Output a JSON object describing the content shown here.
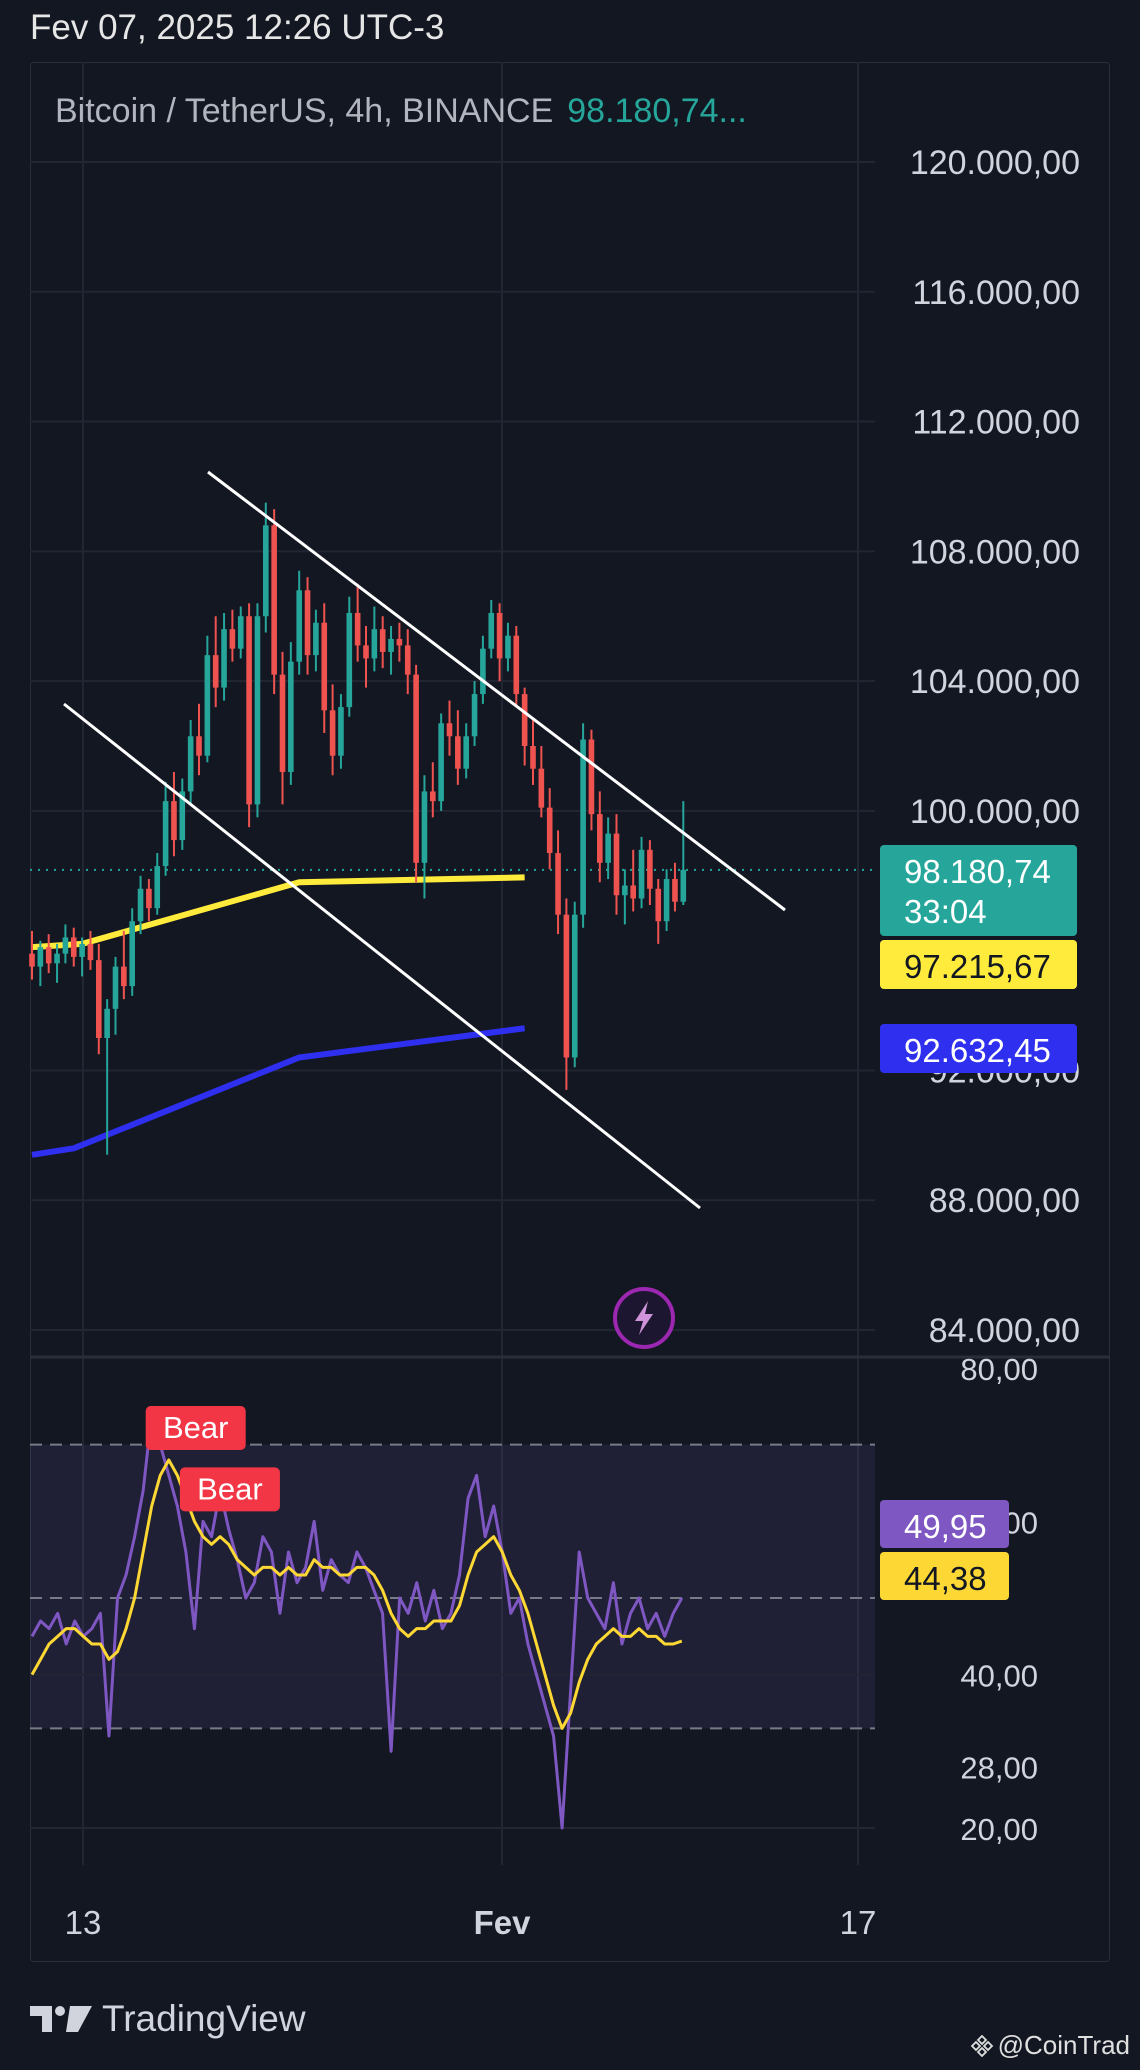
{
  "header": {
    "datetime": "Fev 07, 2025 12:26 UTC-3"
  },
  "symbol": {
    "name": "Bitcoin / TetherUS, 4h, BINANCE",
    "price": "98.180,74..."
  },
  "badges": {
    "last_price": "98.180,74",
    "countdown": "33:04",
    "ema_short": "97.215,67",
    "ema_long": "92.632,45",
    "rsi": "49,95",
    "rsi_ma": "44,38"
  },
  "footer": {
    "brand": "TradingView",
    "watermark": "@CoinTrad"
  },
  "icons": {
    "lightning": "lightning-bolt-icon",
    "logo": "tradingview-logo-icon",
    "binance": "binance-square-icon"
  },
  "colors": {
    "background": "#131722",
    "up": "#26a69a",
    "down": "#ef5350",
    "ema_short": "#ffeb3b",
    "ema_long": "#2f2ff0",
    "rsi": "#7e57c2",
    "rsi_ma": "#fdd835",
    "trendline": "#ffffff",
    "bear": "#f23645",
    "lightning": "#9c27b0"
  },
  "chart_data": [
    {
      "type": "candlestick",
      "symbol": "BTCUSDT",
      "interval": "4h",
      "yaxis_ticks": [
        "120.000,00",
        "116.000,00",
        "112.000,00",
        "108.000,00",
        "104.000,00",
        "100.000,00",
        "88.000,00",
        "84.000,00"
      ],
      "xaxis_ticks": [
        "13",
        "Fev",
        "17"
      ],
      "ylim": [
        84000,
        121000
      ],
      "last_price": 98180.74,
      "candles": [
        [
          95600,
          96300,
          94800,
          95200
        ],
        [
          95200,
          96000,
          94600,
          95800
        ],
        [
          95800,
          96200,
          95000,
          95300
        ],
        [
          95300,
          95900,
          94700,
          95600
        ],
        [
          95600,
          96500,
          95300,
          96100
        ],
        [
          96100,
          96400,
          95200,
          95500
        ],
        [
          95500,
          96100,
          94900,
          95900
        ],
        [
          95900,
          96300,
          95100,
          95400
        ],
        [
          95400,
          95900,
          92500,
          93000
        ],
        [
          93000,
          94200,
          89400,
          93900
        ],
        [
          93900,
          95500,
          93100,
          95200
        ],
        [
          95200,
          96300,
          94200,
          94600
        ],
        [
          94600,
          97000,
          94300,
          96600
        ],
        [
          96600,
          98000,
          96200,
          97600
        ],
        [
          97600,
          97900,
          96600,
          97000
        ],
        [
          97000,
          98700,
          96800,
          98300
        ],
        [
          98300,
          100900,
          98000,
          100300
        ],
        [
          100300,
          101200,
          98600,
          99100
        ],
        [
          99100,
          101000,
          98800,
          100600
        ],
        [
          100600,
          102800,
          100200,
          102300
        ],
        [
          102300,
          103300,
          101100,
          101700
        ],
        [
          101700,
          105400,
          101500,
          104800
        ],
        [
          104800,
          106000,
          103200,
          103800
        ],
        [
          103800,
          106100,
          103400,
          105600
        ],
        [
          105600,
          106200,
          104600,
          105000
        ],
        [
          105000,
          106300,
          104700,
          106000
        ],
        [
          106000,
          106400,
          99500,
          100200
        ],
        [
          100200,
          106400,
          99800,
          106000
        ],
        [
          106000,
          109500,
          105500,
          108800
        ],
        [
          108800,
          109300,
          103600,
          104200
        ],
        [
          104200,
          104900,
          100200,
          101200
        ],
        [
          101200,
          105200,
          100800,
          104600
        ],
        [
          104600,
          107400,
          104200,
          106800
        ],
        [
          106800,
          107200,
          104200,
          104800
        ],
        [
          104800,
          106200,
          104300,
          105800
        ],
        [
          105800,
          106400,
          102400,
          103100
        ],
        [
          103100,
          103900,
          101100,
          101700
        ],
        [
          101700,
          103600,
          101300,
          103200
        ],
        [
          103200,
          106600,
          102900,
          106100
        ],
        [
          106100,
          107000,
          104600,
          105100
        ],
        [
          105100,
          105700,
          103800,
          104700
        ],
        [
          104700,
          106300,
          104300,
          105600
        ],
        [
          105600,
          106000,
          104400,
          104900
        ],
        [
          104900,
          105700,
          104200,
          105300
        ],
        [
          105300,
          105800,
          104600,
          105100
        ],
        [
          105100,
          105600,
          103600,
          104200
        ],
        [
          104200,
          104500,
          97800,
          98400
        ],
        [
          98400,
          101100,
          97300,
          100600
        ],
        [
          100600,
          101500,
          99800,
          100300
        ],
        [
          100300,
          103000,
          100000,
          102700
        ],
        [
          102700,
          103400,
          101700,
          102300
        ],
        [
          102300,
          103100,
          100800,
          101300
        ],
        [
          101300,
          102700,
          101000,
          102300
        ],
        [
          102300,
          104000,
          102000,
          103600
        ],
        [
          103600,
          105400,
          103300,
          105000
        ],
        [
          105000,
          106500,
          104700,
          106100
        ],
        [
          106100,
          106400,
          104000,
          104700
        ],
        [
          104700,
          105800,
          104300,
          105400
        ],
        [
          105400,
          105700,
          103200,
          103600
        ],
        [
          103600,
          103800,
          101400,
          102000
        ],
        [
          102000,
          102800,
          100800,
          101300
        ],
        [
          101300,
          102000,
          99800,
          100100
        ],
        [
          100100,
          100700,
          98200,
          98700
        ],
        [
          98700,
          99400,
          96200,
          96800
        ],
        [
          96800,
          97300,
          91400,
          92400
        ],
        [
          92400,
          97200,
          92100,
          96800
        ],
        [
          96800,
          102700,
          96400,
          102200
        ],
        [
          102200,
          102500,
          99400,
          99900
        ],
        [
          99900,
          100600,
          97800,
          98400
        ],
        [
          98400,
          99800,
          97900,
          99300
        ],
        [
          99300,
          99900,
          96800,
          97400
        ],
        [
          97400,
          98200,
          96500,
          97700
        ],
        [
          97700,
          98800,
          96900,
          97300
        ],
        [
          97300,
          99200,
          97000,
          98800
        ],
        [
          98800,
          99100,
          97100,
          97600
        ],
        [
          97600,
          97900,
          95900,
          96600
        ],
        [
          96600,
          98200,
          96300,
          97900
        ],
        [
          97900,
          98400,
          96900,
          97200
        ],
        [
          97200,
          100300,
          97100,
          98180.74
        ]
      ],
      "series": [
        {
          "values": [
            [
              0,
              95800
            ],
            [
              6,
              95900
            ],
            [
              32,
              97800
            ],
            [
              59,
              97950
            ]
          ]
        },
        {
          "values": [
            [
              0,
              89400
            ],
            [
              5,
              89600
            ],
            [
              32,
              92400
            ],
            [
              59,
              93300
            ]
          ]
        }
      ]
    },
    {
      "type": "line",
      "yaxis_ticks": [
        "80,00",
        "60,00",
        "28,00",
        "20,00"
      ],
      "ylim": [
        18,
        82
      ],
      "bands": [
        33,
        70
      ],
      "midline": 50,
      "annotations": [
        {
          "text": "Bear",
          "index": 14,
          "value": 74
        },
        {
          "text": "Bear",
          "index": 18,
          "value": 66
        }
      ],
      "series": [
        {
          "values": [
            45,
            47,
            46,
            48,
            44,
            47,
            45,
            46,
            48,
            32,
            50,
            53,
            58,
            64,
            74,
            70,
            66,
            62,
            56,
            46,
            60,
            58,
            64,
            59,
            55,
            50,
            52,
            58,
            56,
            48,
            56,
            52,
            54,
            60,
            51,
            55,
            53,
            52,
            56,
            54,
            51,
            48,
            30,
            50,
            48,
            52,
            47,
            51,
            46,
            48,
            53,
            63,
            66,
            58,
            62,
            56,
            48,
            50,
            44,
            40,
            36,
            32,
            20,
            38,
            56,
            50,
            48,
            46,
            52,
            44,
            48,
            50,
            46,
            48,
            45,
            48,
            50
          ]
        },
        {
          "values": [
            40,
            42,
            44,
            45,
            46,
            46,
            45,
            44,
            44,
            42,
            43,
            46,
            50,
            56,
            62,
            66,
            68,
            66,
            63,
            60,
            58,
            57,
            58,
            57,
            55,
            54,
            53,
            54,
            54,
            53,
            54,
            53,
            53,
            55,
            54,
            54,
            53,
            53,
            54,
            54,
            53,
            51,
            48,
            46,
            45,
            46,
            46,
            47,
            47,
            47,
            49,
            53,
            56,
            57,
            58,
            56,
            53,
            51,
            48,
            44,
            40,
            36,
            33,
            35,
            39,
            42,
            44,
            45,
            46,
            45,
            45,
            46,
            45,
            45,
            44,
            44,
            44.38
          ]
        }
      ],
      "current_value": 49.95,
      "current_ma": 44.38
    }
  ]
}
